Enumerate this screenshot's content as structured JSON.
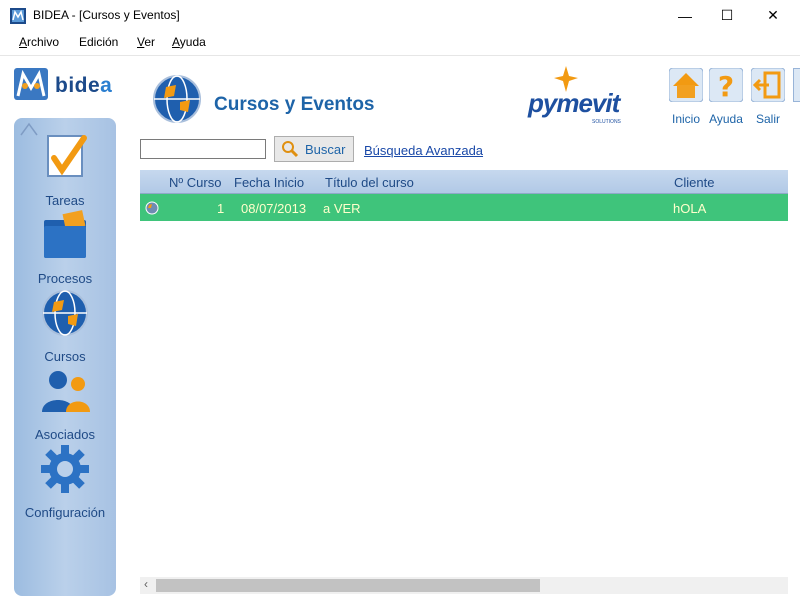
{
  "window": {
    "title": "BIDEA - [Cursos y Eventos]",
    "controls": {
      "minimize": "—",
      "maximize": "☐",
      "close": "✕"
    }
  },
  "menu": {
    "items": [
      {
        "key": "A",
        "rest": "rchivo"
      },
      {
        "key": "",
        "rest": "Edición"
      },
      {
        "key": "V",
        "rest": "er"
      },
      {
        "key": "A",
        "rest": "yuda"
      }
    ]
  },
  "logo": {
    "text_main": "bide",
    "text_accent": "a"
  },
  "sidebar": {
    "items": [
      {
        "label": "Tareas",
        "icon": "check-icon"
      },
      {
        "label": "Procesos",
        "icon": "folder-icon"
      },
      {
        "label": "Cursos",
        "icon": "globe-icon"
      },
      {
        "label": "Asociados",
        "icon": "people-icon"
      },
      {
        "label": "Configuración",
        "icon": "gear-icon"
      }
    ]
  },
  "header": {
    "title": "Cursos y Eventos",
    "brand": "pymevit",
    "brand_sub": "SOLUTIONS",
    "buttons": [
      {
        "label": "Inicio",
        "icon": "home-icon"
      },
      {
        "label": "Ayuda",
        "icon": "help-icon"
      },
      {
        "label": "Salir",
        "icon": "exit-icon"
      }
    ]
  },
  "search": {
    "value": "",
    "button_label": "Buscar",
    "advanced_link": "Búsqueda Avanzada"
  },
  "table": {
    "columns": [
      "Nº Curso",
      "Fecha Inicio",
      "Título del curso",
      "Cliente"
    ],
    "rows": [
      {
        "numero": "1",
        "fecha": "08/07/2013",
        "titulo": "a VER",
        "cliente": "hOLA"
      }
    ]
  },
  "colors": {
    "accent_blue": "#1e64a8",
    "row_selected": "#3fc47b",
    "row_text": "#ffffcc",
    "sidebar": "#a7c2e3"
  }
}
